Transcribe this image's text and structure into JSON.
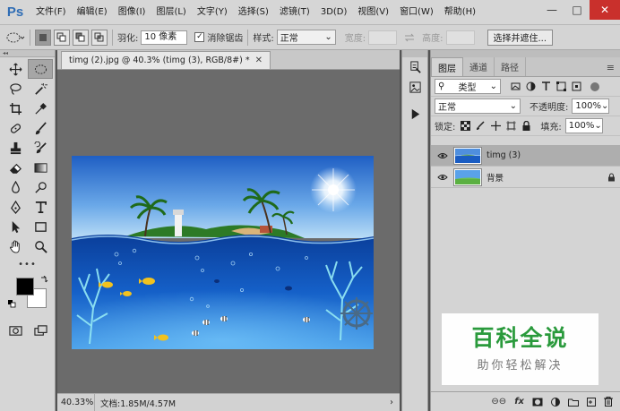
{
  "app": {
    "logo": "Ps"
  },
  "menu": [
    "文件(F)",
    "编辑(E)",
    "图像(I)",
    "图层(L)",
    "文字(Y)",
    "选择(S)",
    "滤镜(T)",
    "3D(D)",
    "视图(V)",
    "窗口(W)",
    "帮助(H)"
  ],
  "window_controls": {
    "minimize": "—",
    "maximize": "□",
    "close": "✕"
  },
  "options": {
    "feather_label": "羽化:",
    "feather_value": "10 像素",
    "antialias_label": "消除锯齿",
    "style_label": "样式:",
    "style_value": "正常",
    "width_label": "宽度:",
    "height_label": "高度:",
    "select_mask_button": "选择并遮住..."
  },
  "document": {
    "tab_title": "timg (2).jpg @ 40.3% (timg (3), RGB/8#) *",
    "zoom": "40.33%",
    "doc_size": "文档:1.85M/4.57M"
  },
  "layers_panel": {
    "tabs": [
      "图层",
      "通道",
      "路径"
    ],
    "filter_kind": "类型",
    "blend_mode": "正常",
    "opacity_label": "不透明度:",
    "opacity_value": "100%",
    "lock_label": "锁定:",
    "fill_label": "填充:",
    "fill_value": "100%",
    "layers": [
      {
        "name": "timg (3)",
        "selected": true,
        "locked": false
      },
      {
        "name": "背景",
        "selected": false,
        "locked": true
      }
    ],
    "bottom_fx": "fx"
  },
  "watermark": {
    "title": "百科全说",
    "subtitle": "助你轻松解决"
  }
}
